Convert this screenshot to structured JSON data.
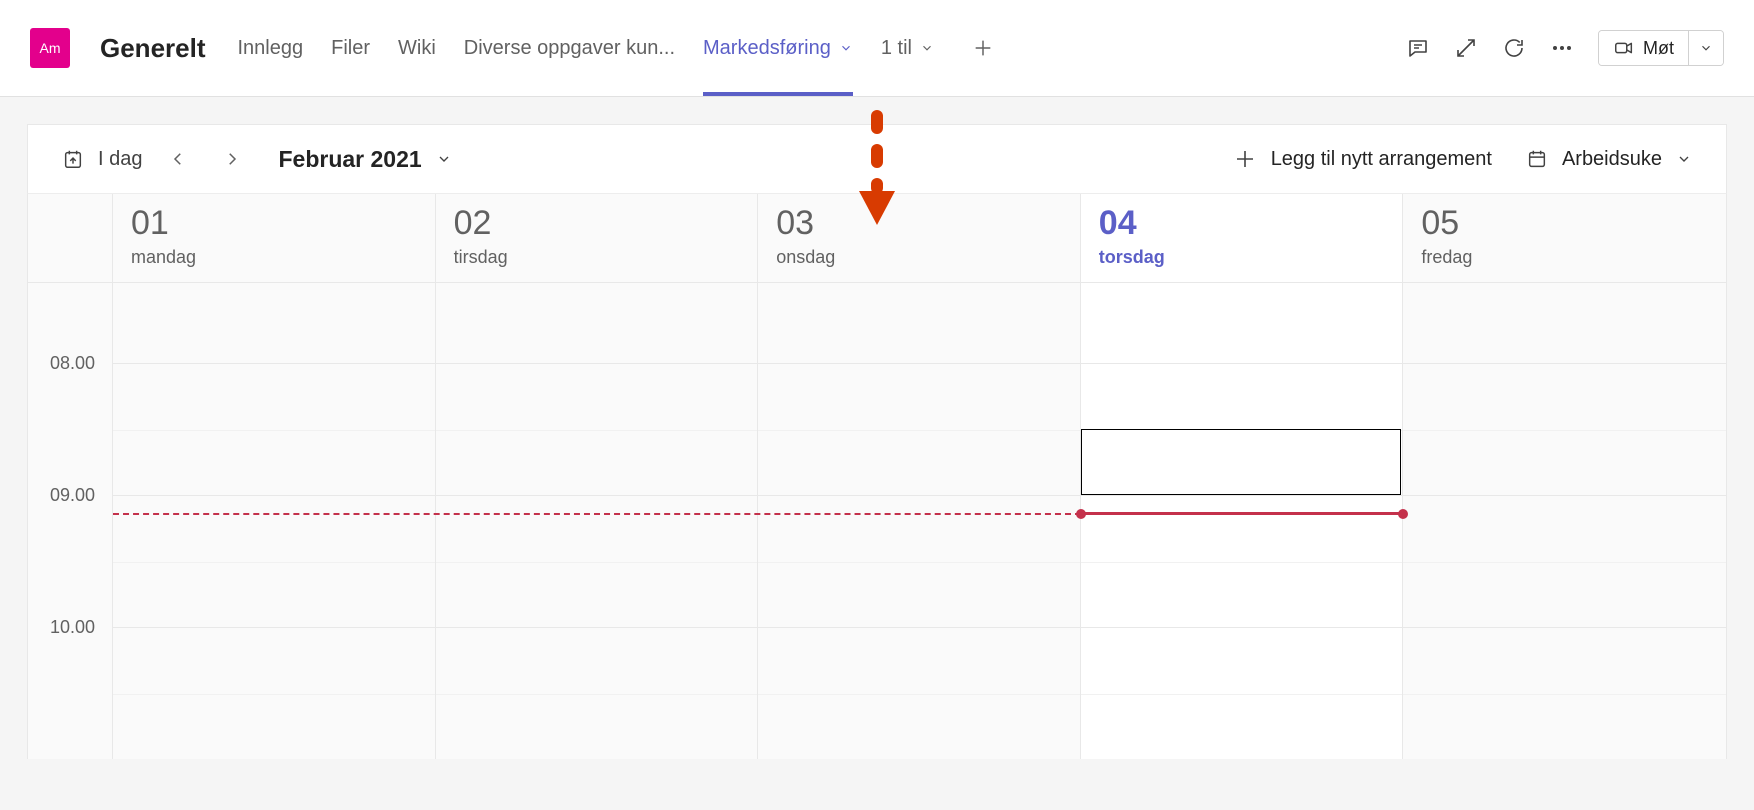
{
  "header": {
    "avatar_label": "Am",
    "channel_name": "Generelt",
    "tabs": {
      "posts": "Innlegg",
      "files": "Filer",
      "wiki": "Wiki",
      "diverse": "Diverse oppgaver kun...",
      "marketing": "Markedsføring",
      "more": "1 til"
    },
    "meet_label": "Møt"
  },
  "calendar": {
    "today_label": "I dag",
    "month_label": "Februar 2021",
    "add_event_label": "Legg til nytt arrangement",
    "view_label": "Arbeidsuke",
    "days": [
      {
        "num": "01",
        "name": "mandag"
      },
      {
        "num": "02",
        "name": "tirsdag"
      },
      {
        "num": "03",
        "name": "onsdag"
      },
      {
        "num": "04",
        "name": "torsdag"
      },
      {
        "num": "05",
        "name": "fredag"
      }
    ],
    "hours": [
      "08.00",
      "09.00",
      "10.00"
    ]
  }
}
